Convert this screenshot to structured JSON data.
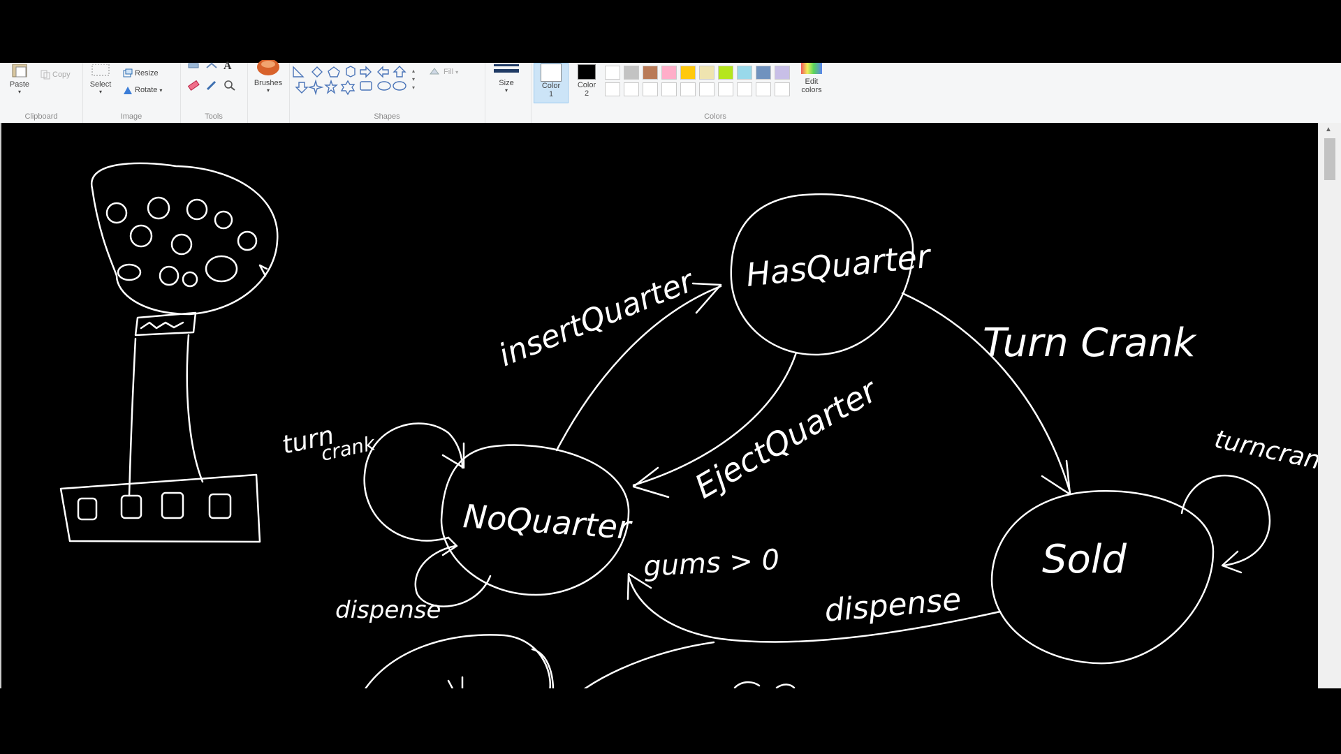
{
  "ribbon": {
    "clipboard": {
      "group_label": "Clipboard",
      "paste_label": "Paste",
      "copy_label": "Copy"
    },
    "image": {
      "group_label": "Image",
      "select_label": "Select",
      "resize_label": "Resize",
      "rotate_label": "Rotate"
    },
    "tools": {
      "group_label": "Tools"
    },
    "brushes": {
      "label": "Brushes"
    },
    "shapes": {
      "group_label": "Shapes",
      "fill_label": "Fill"
    },
    "size": {
      "label": "Size"
    },
    "color1": {
      "label": "Color",
      "num": "1"
    },
    "color2": {
      "label": "Color",
      "num": "2"
    },
    "colors": {
      "group_label": "Colors",
      "edit_label_1": "Edit",
      "edit_label_2": "colors",
      "row1": [
        "#ffffff",
        "#c3c3c3",
        "#b97a57",
        "#ffaec9",
        "#ffc90e",
        "#efe4b0",
        "#b5e61d",
        "#99d9ea",
        "#7092be",
        "#c8bfe7"
      ],
      "row2": [
        "#ffffff",
        "#ffffff",
        "#ffffff",
        "#ffffff",
        "#ffffff",
        "#ffffff",
        "#ffffff",
        "#ffffff",
        "#ffffff",
        "#ffffff"
      ],
      "color1_value": "#ffffff",
      "color2_value": "#000000"
    }
  },
  "drawing": {
    "states": {
      "has_quarter": "HasQuarter",
      "no_quarter": "NoQuarter",
      "sold": "Sold"
    },
    "transitions": {
      "insert_quarter": "insertQuarter",
      "eject_quarter": "EjectQuarter",
      "turn_crank_main": "Turn Crank",
      "turn_crank_loop_1": "turn",
      "turn_crank_loop_2": "crank",
      "turn_crank_sold": "turncrank",
      "dispense_loop": "dispense",
      "dispense_main": "dispense",
      "gums_guard": "gums > 0"
    }
  }
}
